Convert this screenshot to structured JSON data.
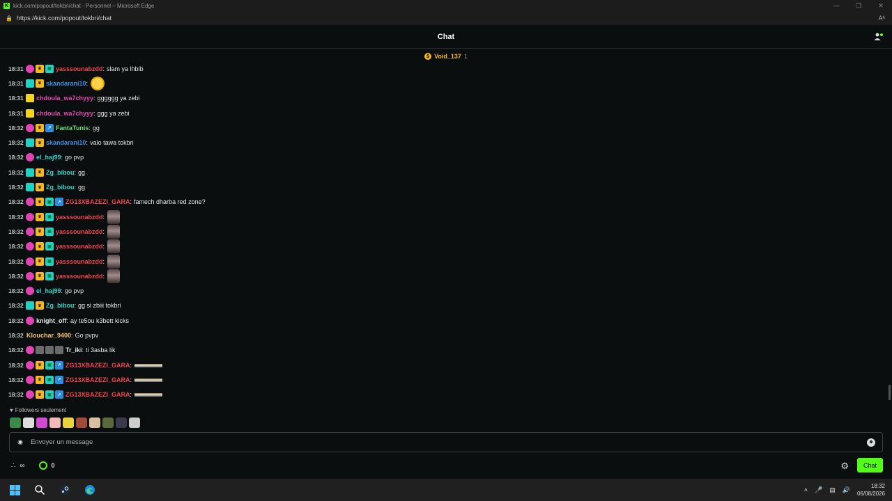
{
  "window": {
    "title": "kick.com/popout/tokbri/chat - Personnel – Microsoft Edge",
    "url": "https://kick.com/popout/tokbri/chat",
    "reader_label": "Aʰ"
  },
  "header": {
    "title": "Chat"
  },
  "pinned": {
    "name": "Void_137",
    "count": "1"
  },
  "messages": [
    {
      "time": "18:31",
      "badges": [
        "sub",
        "crown",
        "gift"
      ],
      "user": "yasssounabzdd",
      "color": "#f0454f",
      "text": "slam ya lhbib",
      "emotes": []
    },
    {
      "time": "18:31",
      "badges": [
        "num-c",
        "crown"
      ],
      "user": "skandarani10",
      "color": "#3d8fe8",
      "text": "",
      "emotes": [
        "face"
      ]
    },
    {
      "time": "18:31",
      "badges": [
        "num-y"
      ],
      "user": "chdoula_wa7chyyy",
      "color": "#e44bb0",
      "text": "gggggg ya zebi",
      "emotes": []
    },
    {
      "time": "18:31",
      "badges": [
        "num-y"
      ],
      "user": "chdoula_wa7chyyy",
      "color": "#e44bb0",
      "text": "ggg ya zebi",
      "emotes": []
    },
    {
      "time": "18:32",
      "badges": [
        "sub",
        "crown",
        "og"
      ],
      "user": "FantaTunis",
      "color": "#67e07a",
      "text": "gg",
      "emotes": []
    },
    {
      "time": "18:32",
      "badges": [
        "num-c",
        "crown"
      ],
      "user": "skandarani10",
      "color": "#3d8fe8",
      "text": "valo tawa tokbri",
      "emotes": []
    },
    {
      "time": "18:32",
      "badges": [
        "sub"
      ],
      "user": "el_haj99",
      "color": "#32d4c8",
      "text": "go pvp",
      "emotes": []
    },
    {
      "time": "18:32",
      "badges": [
        "num-c",
        "crown"
      ],
      "user": "Zg_bibou",
      "color": "#32d4c8",
      "text": "gg",
      "emotes": []
    },
    {
      "time": "18:32",
      "badges": [
        "num-c",
        "crown"
      ],
      "user": "Zg_bibou",
      "color": "#32d4c8",
      "text": "gg",
      "emotes": []
    },
    {
      "time": "18:32",
      "badges": [
        "sub",
        "crown",
        "gift",
        "og"
      ],
      "user": "ZG13XBAZEZI_GARA",
      "color": "#f0454f",
      "text": "famech dharba red zone?",
      "emotes": []
    },
    {
      "time": "18:32",
      "badges": [
        "sub",
        "crown",
        "gift"
      ],
      "user": "yasssounabzdd",
      "color": "#f0454f",
      "text": "",
      "emotes": [
        "photo"
      ]
    },
    {
      "time": "18:32",
      "badges": [
        "sub",
        "crown",
        "gift"
      ],
      "user": "yasssounabzdd",
      "color": "#f0454f",
      "text": "",
      "emotes": [
        "photo"
      ]
    },
    {
      "time": "18:32",
      "badges": [
        "sub",
        "crown",
        "gift"
      ],
      "user": "yasssounabzdd",
      "color": "#f0454f",
      "text": "",
      "emotes": [
        "photo"
      ]
    },
    {
      "time": "18:32",
      "badges": [
        "sub",
        "crown",
        "gift"
      ],
      "user": "yasssounabzdd",
      "color": "#f0454f",
      "text": "",
      "emotes": [
        "photo"
      ]
    },
    {
      "time": "18:32",
      "badges": [
        "sub",
        "crown",
        "gift"
      ],
      "user": "yasssounabzdd",
      "color": "#f0454f",
      "text": "",
      "emotes": [
        "photo"
      ]
    },
    {
      "time": "18:32",
      "badges": [
        "sub"
      ],
      "user": "el_haj99",
      "color": "#32d4c8",
      "text": "go pvp",
      "emotes": []
    },
    {
      "time": "18:32",
      "badges": [
        "num-c",
        "crown"
      ],
      "user": "Zg_bibou",
      "color": "#32d4c8",
      "text": "gg si zbiii tokbri",
      "emotes": []
    },
    {
      "time": "18:32",
      "badges": [
        "sub"
      ],
      "user": "knight_off",
      "color": "#e6e6e6",
      "text": "ay te5ou k3bett kicks",
      "emotes": []
    },
    {
      "time": "18:32",
      "badges": [],
      "user": "Klouchar_9400",
      "color": "#f5c46b",
      "text": "Go pvpv",
      "emotes": []
    },
    {
      "time": "18:32",
      "badges": [
        "sub",
        "misc",
        "misc",
        "misc"
      ],
      "user": "Tr_iki",
      "color": "#e6e6e6",
      "text": "ti 3asba lik",
      "emotes": []
    },
    {
      "time": "18:32",
      "badges": [
        "sub",
        "crown",
        "gift",
        "og"
      ],
      "user": "ZG13XBAZEZI_GARA",
      "color": "#f0454f",
      "text": "",
      "emotes": [
        "car"
      ]
    },
    {
      "time": "18:32",
      "badges": [
        "sub",
        "crown",
        "gift",
        "og"
      ],
      "user": "ZG13XBAZEZI_GARA",
      "color": "#f0454f",
      "text": "",
      "emotes": [
        "car"
      ]
    },
    {
      "time": "18:32",
      "badges": [
        "sub",
        "crown",
        "gift",
        "og"
      ],
      "user": "ZG13XBAZEZI_GARA",
      "color": "#f0454f",
      "text": "",
      "emotes": [
        "car"
      ]
    }
  ],
  "followers_label": "Followers seulement",
  "emote_bar": [
    "#3a8a4a",
    "#dddddd",
    "#d04bd0",
    "#f2b9b9",
    "#e8d43a",
    "#a04a3a",
    "#d8c0a0",
    "#5a6a3a",
    "#3a3a4a",
    "#cccccc"
  ],
  "input": {
    "placeholder": "Envoyer un message"
  },
  "footer": {
    "infinity": "∞",
    "points": "0",
    "chat_button": "Chat"
  },
  "taskbar": {
    "time": "18:32",
    "date": "06/08/2026"
  },
  "colors": {
    "accent": "#53fc18",
    "background": "#0b0e0f"
  }
}
